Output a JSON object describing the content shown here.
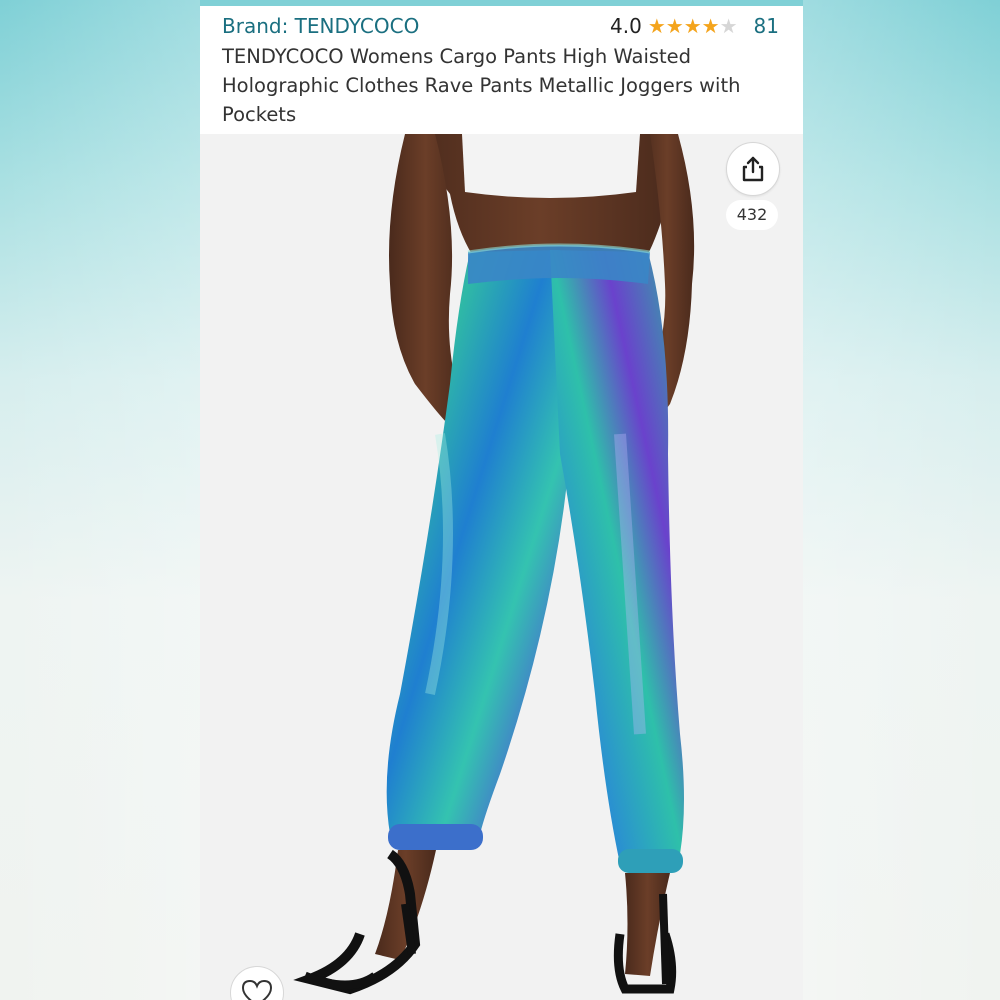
{
  "product": {
    "brand_label": "Brand: TENDYCOCO",
    "rating_value": "4.0",
    "rating": 4.0,
    "rating_max": 5,
    "review_count": "81",
    "title": "TENDYCOCO Womens Cargo Pants High Waisted Holographic Clothes Rave Pants Metallic Joggers with Pockets"
  },
  "actions": {
    "share_icon": "share-icon",
    "share_count": "432",
    "favorite_icon": "heart-icon"
  },
  "colors": {
    "link": "#1a6f80",
    "star": "#f4a41c",
    "pants_teal": "#1fb3a0",
    "pants_violet": "#6a3fc9"
  }
}
